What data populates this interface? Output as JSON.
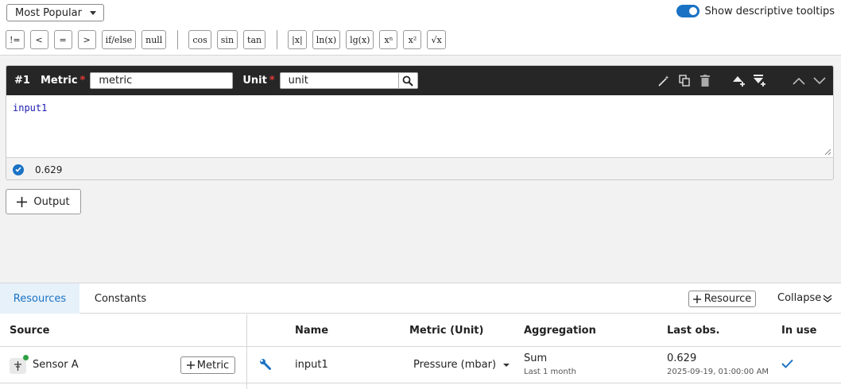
{
  "toolbar": {
    "preset_select": "Most Popular",
    "tooltip_toggle_label": "Show descriptive tooltips",
    "functions": [
      [
        "!=",
        "<",
        "=",
        ">",
        "if/else",
        "null"
      ],
      [
        "cos",
        "sin",
        "tan"
      ],
      [
        "|x|",
        "ln(x)",
        "lg(x)",
        "xⁿ",
        "x²",
        "√x"
      ]
    ]
  },
  "formula": {
    "number": "#1",
    "metric_label": "Metric",
    "metric_value": "metric",
    "unit_label": "Unit",
    "unit_value": "unit",
    "expression": "input1",
    "result": "0.629"
  },
  "output_button": "Output",
  "panel": {
    "tabs": [
      "Resources",
      "Constants"
    ],
    "add_resource": "Resource",
    "collapse": "Collapse",
    "columns": {
      "source": "Source",
      "name": "Name",
      "metric_unit": "Metric (Unit)",
      "aggregation": "Aggregation",
      "last_obs": "Last obs.",
      "in_use": "In use"
    },
    "rows": [
      {
        "source": "Sensor A",
        "add_metric": "Metric",
        "name": "input1",
        "metric_unit": "Pressure (mbar)",
        "aggregation": "Sum",
        "aggregation_period": "Last 1 month",
        "last_value": "0.629",
        "last_time": "2025-09-19, 01:00:00 AM"
      }
    ]
  },
  "colors": {
    "accent": "#1a72c4",
    "header": "#262626",
    "required": "#e53935",
    "online": "#2ea043"
  }
}
